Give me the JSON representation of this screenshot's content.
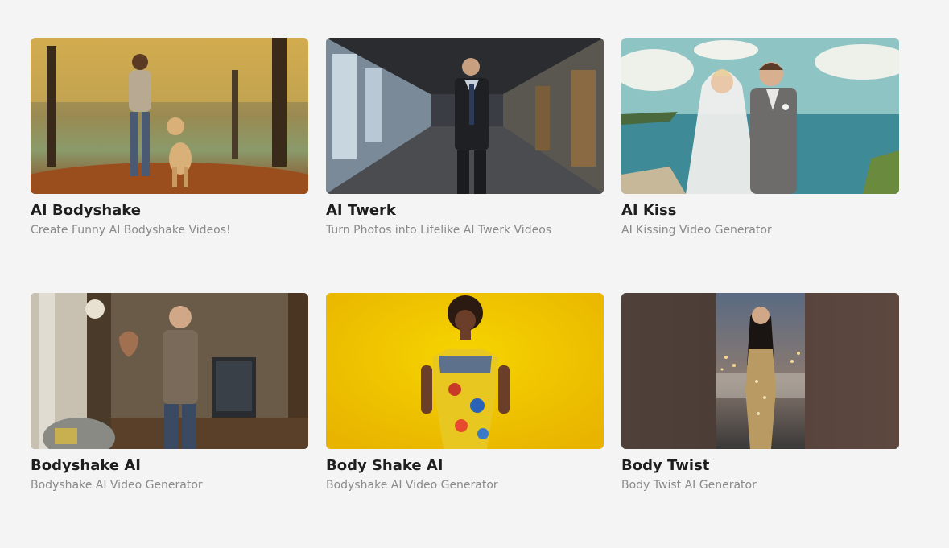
{
  "cards": [
    {
      "title": "AI Bodyshake",
      "subtitle": "Create Funny AI Bodyshake Videos!",
      "image": "woman-walking-golden-retriever-autumn-park"
    },
    {
      "title": "AI Twerk",
      "subtitle": "Turn Photos into Lifelike AI Twerk Videos",
      "image": "man-in-suit-office-hallway"
    },
    {
      "title": "AI Kiss",
      "subtitle": "AI Kissing Video Generator",
      "image": "bride-and-groom-seaside"
    },
    {
      "title": "Bodyshake AI",
      "subtitle": "Bodyshake AI Video Generator",
      "image": "older-man-living-room"
    },
    {
      "title": "Body Shake AI",
      "subtitle": "Bodyshake AI Video Generator",
      "image": "woman-yellow-background-floral-dress"
    },
    {
      "title": "Body Twist",
      "subtitle": "Body Twist AI Generator",
      "image": "woman-gold-dress-city-night"
    }
  ]
}
